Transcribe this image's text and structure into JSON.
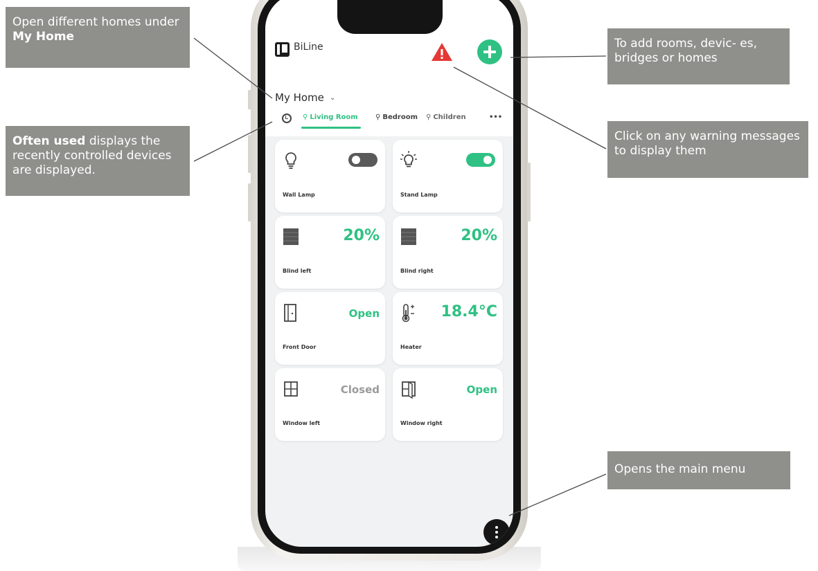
{
  "callouts": {
    "homes": {
      "text": "Open different homes under ",
      "bold": "My Home"
    },
    "often": {
      "bold": "Often used",
      "text": " displays the recently controlled devices are displayed."
    },
    "add": {
      "text": "To add rooms, devic- es, bridges or homes"
    },
    "warn": {
      "text": "Click on any warning messages to display them"
    },
    "menu": {
      "text": "Opens the main menu"
    }
  },
  "app": {
    "name": "BiLine",
    "home_title": "My Home",
    "tabs": [
      {
        "label": "Living Room",
        "active": true
      },
      {
        "label": "Bedroom",
        "active": false
      },
      {
        "label": "Children",
        "active": false
      }
    ],
    "more_label": "•••",
    "accent_color": "#2fc183",
    "warning_color": "#e53935"
  },
  "tiles": [
    {
      "label": "Wall Lamp",
      "icon": "bulb-icon",
      "toggle": "off"
    },
    {
      "label": "Stand Lamp",
      "icon": "bulb-on-icon",
      "toggle": "on"
    },
    {
      "label": "Blind left",
      "icon": "blind-icon",
      "value": "20%"
    },
    {
      "label": "Blind right",
      "icon": "blind-icon",
      "value": "20%"
    },
    {
      "label": "Front Door",
      "icon": "door-icon",
      "value": "Open"
    },
    {
      "label": "Heater",
      "icon": "thermometer-icon",
      "value": "18.4°C"
    },
    {
      "label": "Window left",
      "icon": "window-icon",
      "value": "Closed"
    },
    {
      "label": "Window right",
      "icon": "window-open-icon",
      "value": "Open"
    }
  ]
}
